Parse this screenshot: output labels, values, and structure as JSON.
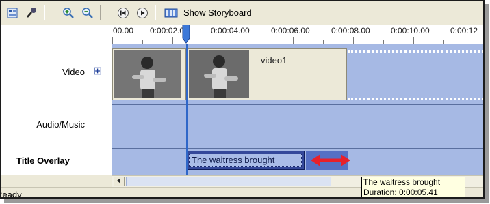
{
  "toolbar": {
    "storyboard_label": "Show Storyboard"
  },
  "ruler": {
    "ticks": [
      "00.00",
      "0:00:02.00",
      "0:00:04.00",
      "0:00:06.00",
      "0:00:08.00",
      "0:00:10.00",
      "0:00:12"
    ]
  },
  "tracks": {
    "video_label": "Video",
    "expand_symbol": "⊞",
    "audio_label": "Audio/Music",
    "title_label": "Title Overlay"
  },
  "clips": {
    "video1_name": "video1",
    "title_text": "The waitress brought"
  },
  "tooltip": {
    "line1": "The waitress brought",
    "line2": "Duration:  0:00:05.41"
  },
  "status": {
    "text": "Ready"
  },
  "colors": {
    "track_bg": "#a6b9e4",
    "playhead": "#2f67c8",
    "arrow": "#e8202a"
  }
}
